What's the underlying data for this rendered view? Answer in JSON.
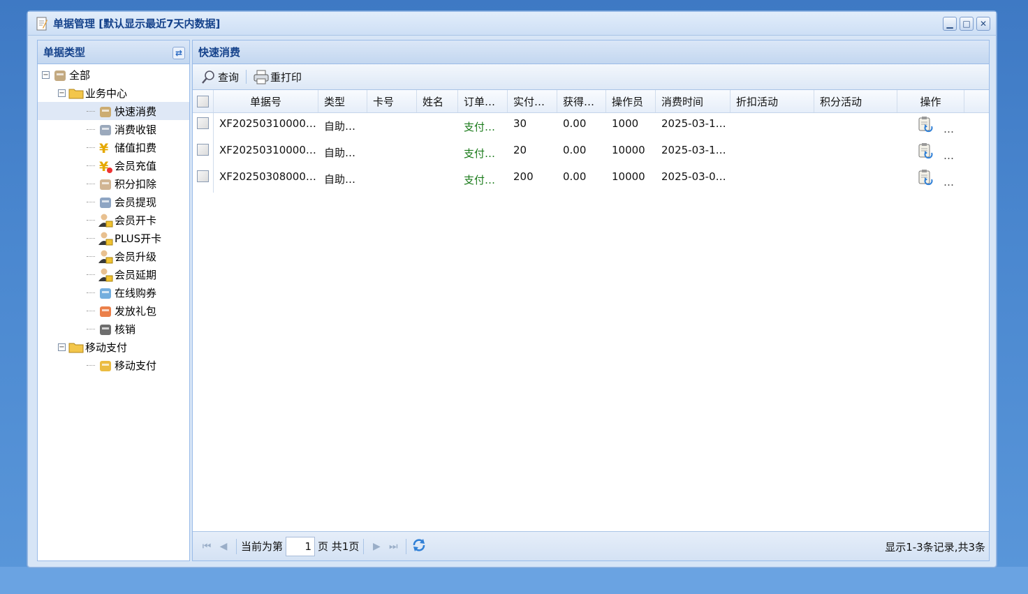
{
  "window": {
    "title": "单据管理 [默认显示最近7天内数据]",
    "minimize": "▁",
    "maximize": "□",
    "close": "✕"
  },
  "left_panel": {
    "title": "单据类型",
    "tree": [
      {
        "label": "全部",
        "level": 0,
        "icon": "all-icon",
        "expander": "−"
      },
      {
        "label": "业务中心",
        "level": 1,
        "icon": "folder-icon",
        "expander": "−"
      },
      {
        "label": "快速消费",
        "level": 2,
        "icon": "money-bag-icon",
        "selected": true
      },
      {
        "label": "消费收银",
        "level": 2,
        "icon": "cash-register-icon"
      },
      {
        "label": "储值扣费",
        "level": 2,
        "icon": "yen-icon"
      },
      {
        "label": "会员充值",
        "level": 2,
        "icon": "yen-add-icon"
      },
      {
        "label": "积分扣除",
        "level": 2,
        "icon": "points-icon"
      },
      {
        "label": "会员提现",
        "level": 2,
        "icon": "card-icon"
      },
      {
        "label": "会员开卡",
        "level": 2,
        "icon": "user-card-icon"
      },
      {
        "label": "PLUS开卡",
        "level": 2,
        "icon": "user-plus-card-icon"
      },
      {
        "label": "会员升级",
        "level": 2,
        "icon": "user-upgrade-icon"
      },
      {
        "label": "会员延期",
        "level": 2,
        "icon": "user-extend-icon"
      },
      {
        "label": "在线购券",
        "level": 2,
        "icon": "cart-icon"
      },
      {
        "label": "发放礼包",
        "level": 2,
        "icon": "gift-icon"
      },
      {
        "label": "核销",
        "level": 2,
        "icon": "laptop-icon"
      },
      {
        "label": "移动支付",
        "level": 1,
        "icon": "folder-icon",
        "expander": "−"
      },
      {
        "label": "移动支付",
        "level": 2,
        "icon": "mobile-pay-icon"
      }
    ]
  },
  "right_panel": {
    "title": "快速消费",
    "toolbar": {
      "query_label": "查询",
      "reprint_label": "重打印"
    },
    "grid": {
      "columns": [
        "单据号",
        "类型",
        "卡号",
        "姓名",
        "订单…",
        "实付…",
        "获得…",
        "操作员",
        "消费时间",
        "折扣活动",
        "积分活动",
        "操作"
      ],
      "rows": [
        {
          "bill_no": "XF20250310000…",
          "type": "自助…",
          "card_no": "",
          "name": "",
          "order": "支付…",
          "paid": "30",
          "earned": "0.00",
          "operator": "1000",
          "time": "2025-03-1…",
          "discount": "",
          "points": "",
          "more": "…"
        },
        {
          "bill_no": "XF20250310000…",
          "type": "自助…",
          "card_no": "",
          "name": "",
          "order": "支付…",
          "paid": "20",
          "earned": "0.00",
          "operator": "10000",
          "time": "2025-03-1…",
          "discount": "",
          "points": "",
          "more": "…"
        },
        {
          "bill_no": "XF20250308000…",
          "type": "自助…",
          "card_no": "",
          "name": "",
          "order": "支付…",
          "paid": "200",
          "earned": "0.00",
          "operator": "10000",
          "time": "2025-03-0…",
          "discount": "",
          "points": "",
          "more": "…"
        }
      ]
    },
    "pager": {
      "current_prefix": "当前为第",
      "current_page": "1",
      "page_suffix": "页 共1页",
      "summary": "显示1-3条记录,共3条"
    }
  },
  "colors": {
    "title_text": "#15428b",
    "border": "#99bbe8",
    "selected_row": "#dfe8f6",
    "green_text": "#1a7a1a"
  }
}
